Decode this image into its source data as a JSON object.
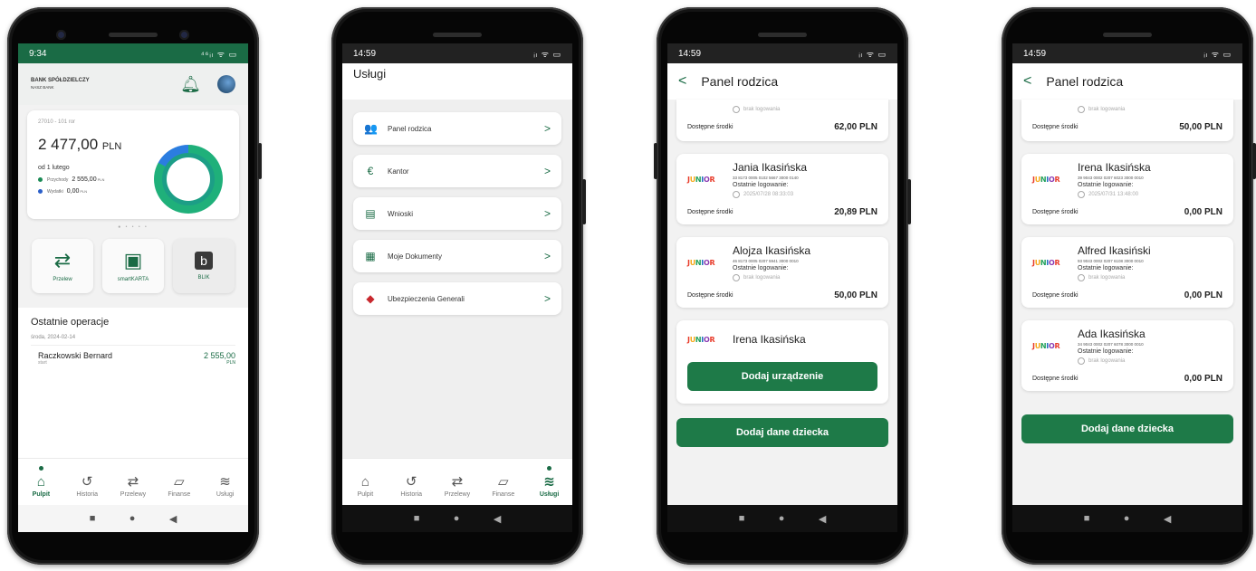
{
  "phone1": {
    "status_time": "9:34",
    "status_icons": "⁴⁶ᵢₗ ᯤ ▭",
    "bank_name": "BANK SPÓŁDZIELCZY",
    "bank_sub": "NASZ BANK",
    "account_number": "27010 - 101 ror",
    "balance": "2 477,00",
    "balance_currency": "PLN",
    "since": "od 1 lutego",
    "income_label": "Przychody",
    "income_value": "2 555,00",
    "income_currency": "PLN",
    "expense_label": "Wydatki",
    "expense_value": "0,00",
    "expense_currency": "PLN",
    "quick_actions": [
      {
        "label": "Przelew",
        "icon": "⇄"
      },
      {
        "label": "smartKARTA",
        "icon": "▣"
      },
      {
        "label": "BLIK",
        "icon": "b"
      }
    ],
    "ops_title": "Ostatnie operacje",
    "ops_date": "środa, 2024-02-14",
    "op_name": "Raczkowski Bernard",
    "op_sub": "start",
    "op_amount": "2 555,00",
    "op_currency": "PLN",
    "tabs": [
      {
        "label": "Pulpit",
        "icon": "⌂"
      },
      {
        "label": "Historia",
        "icon": "↺"
      },
      {
        "label": "Przelewy",
        "icon": "⇄"
      },
      {
        "label": "Finanse",
        "icon": "▱"
      },
      {
        "label": "Usługi",
        "icon": "≋"
      }
    ]
  },
  "phone2": {
    "status_time": "14:59",
    "status_icons": "ᵢₗ ᯤ ▭",
    "title": "Usługi",
    "services": [
      {
        "label": "Panel rodzica",
        "icon": "👥"
      },
      {
        "label": "Kantor",
        "icon": "€"
      },
      {
        "label": "Wnioski",
        "icon": "▤"
      },
      {
        "label": "Moje Dokumenty",
        "icon": "▦"
      },
      {
        "label": "Ubezpieczenia Generali",
        "icon": "◆"
      }
    ],
    "tabs": [
      {
        "label": "Pulpit",
        "icon": "⌂"
      },
      {
        "label": "Historia",
        "icon": "↺"
      },
      {
        "label": "Przelewy",
        "icon": "⇄"
      },
      {
        "label": "Finanse",
        "icon": "▱"
      },
      {
        "label": "Usługi",
        "icon": "≋"
      }
    ]
  },
  "phone3": {
    "status_time": "14:59",
    "status_icons": "ᵢₗ ᯤ ▭",
    "title": "Panel rodzica",
    "top_partial_login": "brak logowania",
    "top_partial_funds_label": "Dostępne środki",
    "top_partial_funds": "62,00 PLN",
    "children": [
      {
        "name": "Jania Ikasińska",
        "account": "33 8173 0005 0102 5667 3000 0140",
        "login_label": "Ostatnie logowanie:",
        "login_value": "2025/07/28 08:33:03",
        "funds_label": "Dostępne środki",
        "funds": "20,89 PLN"
      },
      {
        "name": "Alojza Ikasińska",
        "account": "46 8173 0005 0207 5941 3000 0010",
        "login_label": "Ostatnie logowanie:",
        "login_value": "brak logowania",
        "funds_label": "Dostępne środki",
        "funds": "50,00 PLN"
      }
    ],
    "pending_name": "Irena Ikasińska",
    "add_device": "Dodaj urządzenie",
    "add_child": "Dodaj dane dziecka"
  },
  "phone4": {
    "status_time": "14:59",
    "status_icons": "ᵢₗ ᯤ ▭",
    "title": "Panel rodzica",
    "top_partial_login": "brak logowania",
    "top_partial_funds_label": "Dostępne środki",
    "top_partial_funds": "50,00 PLN",
    "children": [
      {
        "name": "Irena Ikasińska",
        "account": "39 9043 0002 0207 6023 3000 0010",
        "login_label": "Ostatnie logowanie:",
        "login_value": "2025/07/31 13:48:00",
        "funds_label": "Dostępne środki",
        "funds": "0,00 PLN"
      },
      {
        "name": "Alfred Ikasiński",
        "account": "93 9043 0002 0207 6108 3000 0010",
        "login_label": "Ostatnie logowanie:",
        "login_value": "brak logowania",
        "funds_label": "Dostępne środki",
        "funds": "0,00 PLN"
      },
      {
        "name": "Ada Ikasińska",
        "account": "34 9043 0002 0207 6078 3000 0010",
        "login_label": "Ostatnie logowanie:",
        "login_value": "brak logowania",
        "funds_label": "Dostępne środki",
        "funds": "0,00 PLN"
      }
    ],
    "add_child": "Dodaj dane dziecka"
  },
  "junior_logo": "JUNIOR",
  "android_nav": {
    "square": "■",
    "home": "●",
    "back": "◀"
  },
  "colors": {
    "brand_green": "#1a6b45",
    "button_green": "#1e7a48"
  }
}
